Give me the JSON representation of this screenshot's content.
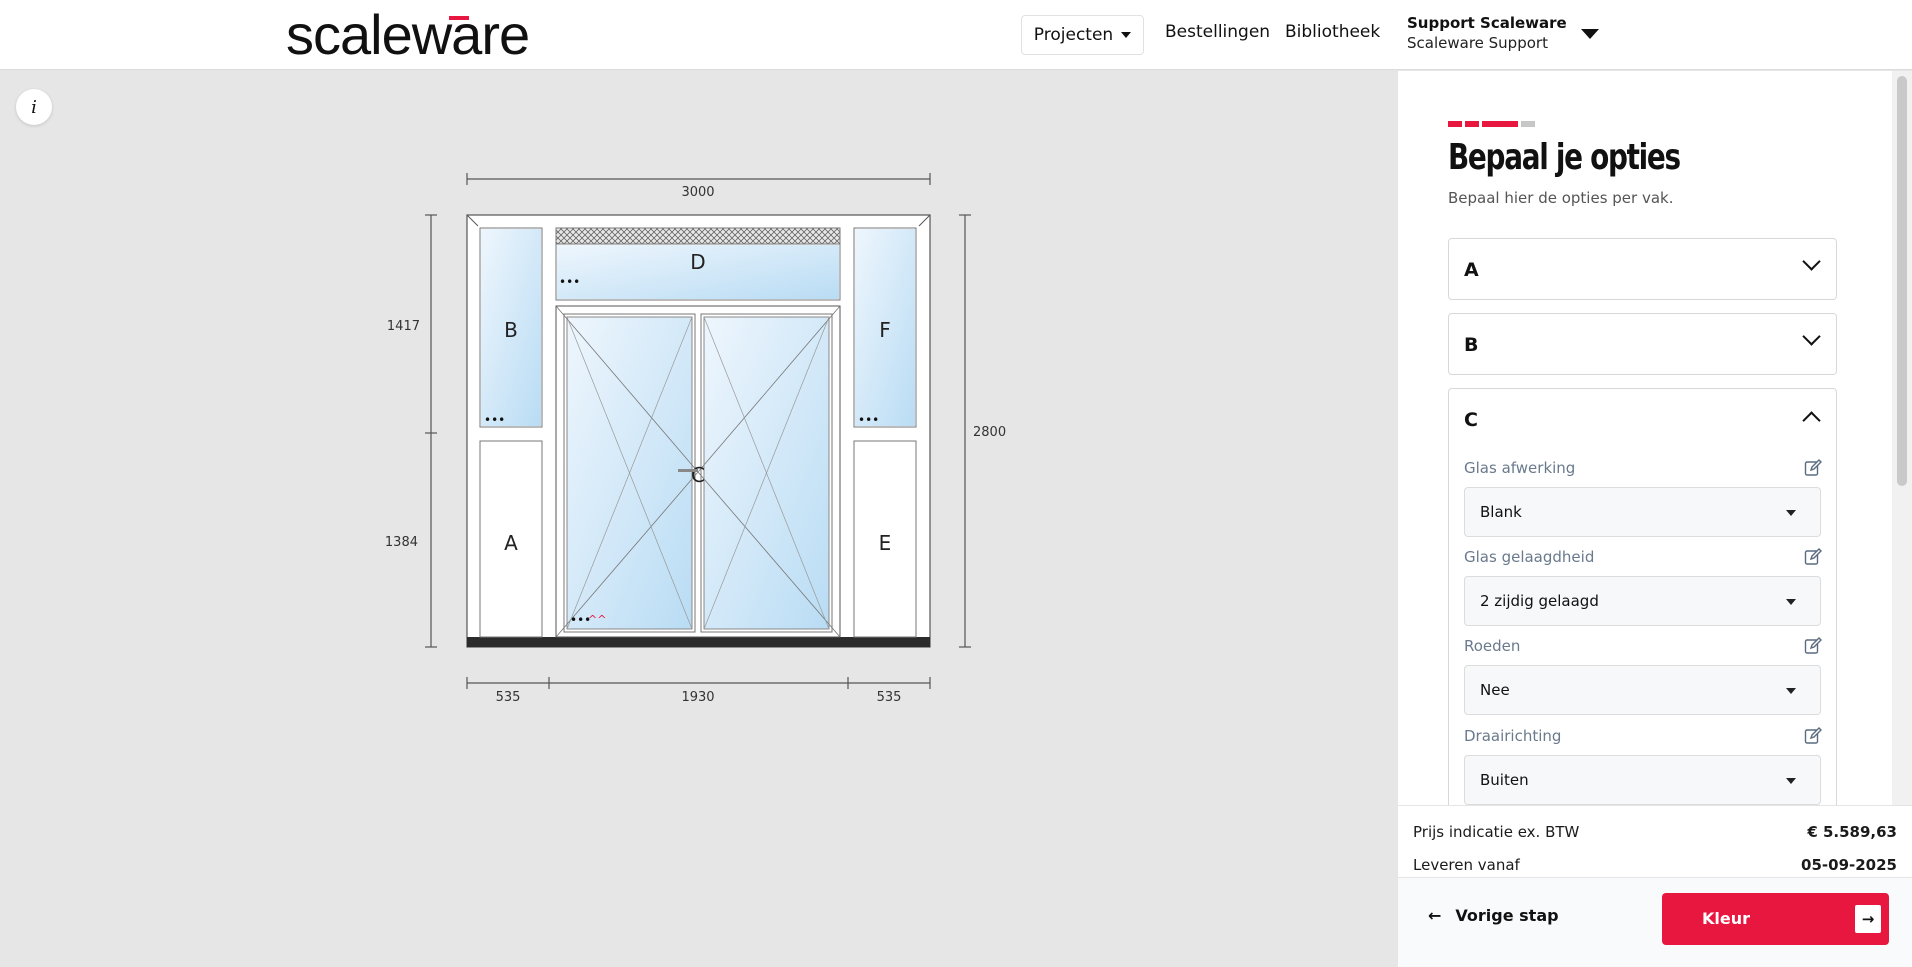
{
  "header": {
    "logo_text": "scaleware",
    "nav_projects": "Projecten",
    "nav_orders": "Bestellingen",
    "nav_library": "Bibliotheek",
    "user_name": "Support Scaleware",
    "user_org": "Scaleware Support"
  },
  "canvas": {
    "info_label": "i",
    "dimensions": {
      "total_width": "3000",
      "total_height": "2800",
      "upper_height": "1417",
      "lower_height": "1384",
      "left_width": "535",
      "middle_width": "1930",
      "right_width": "535"
    },
    "vakken": [
      "A",
      "B",
      "C",
      "D",
      "E",
      "F"
    ]
  },
  "panel": {
    "title": "Bepaal je opties",
    "subtitle": "Bepaal hier de opties per vak.",
    "accordions": [
      {
        "letter": "A",
        "open": false
      },
      {
        "letter": "B",
        "open": false
      },
      {
        "letter": "C",
        "open": true
      }
    ],
    "options": [
      {
        "label": "Glas afwerking",
        "value": "Blank"
      },
      {
        "label": "Glas gelaagdheid",
        "value": "2 zijdig gelaagd"
      },
      {
        "label": "Roeden",
        "value": "Nee"
      },
      {
        "label": "Draairichting",
        "value": "Buiten"
      }
    ],
    "price_label": "Prijs indicatie ex. BTW",
    "price_value": "€ 5.589,63",
    "delivery_label": "Leveren vanaf",
    "delivery_value": "05-09-2025",
    "prev_label": "Vorige stap",
    "next_label": "Kleur"
  },
  "colors": {
    "accent": "#e8173f",
    "glass": "#cfe6f7",
    "frame": "#ffffff"
  }
}
